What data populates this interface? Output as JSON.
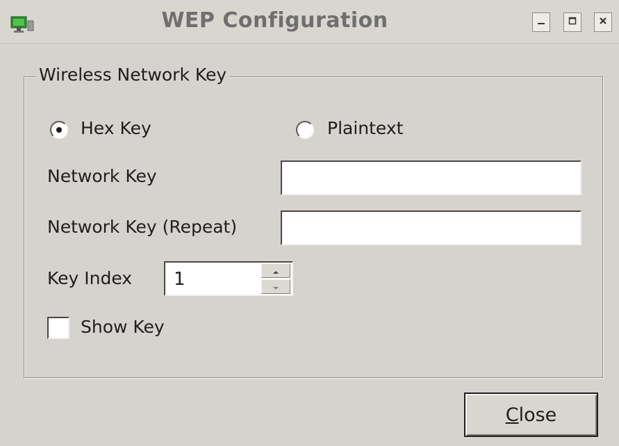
{
  "window": {
    "title": "WEP Configuration",
    "app_icon": "network-monitor-icon",
    "controls": {
      "minimize_icon": "minimize-icon",
      "maximize_icon": "maximize-icon",
      "close_icon": "close-icon"
    }
  },
  "group": {
    "legend": "Wireless Network Key",
    "key_type": {
      "options": [
        {
          "label": "Hex Key",
          "selected": true
        },
        {
          "label": "Plaintext",
          "selected": false
        }
      ]
    },
    "network_key": {
      "label": "Network Key",
      "value": ""
    },
    "network_key_repeat": {
      "label": "Network Key (Repeat)",
      "value": ""
    },
    "key_index": {
      "label": "Key Index",
      "value": "1"
    },
    "show_key": {
      "label": "Show Key",
      "checked": false
    }
  },
  "buttons": {
    "close_label": "Close"
  },
  "colors": {
    "background": "#d6d3ce",
    "title_text": "#6f6f6f",
    "text": "#1e1e1e"
  }
}
